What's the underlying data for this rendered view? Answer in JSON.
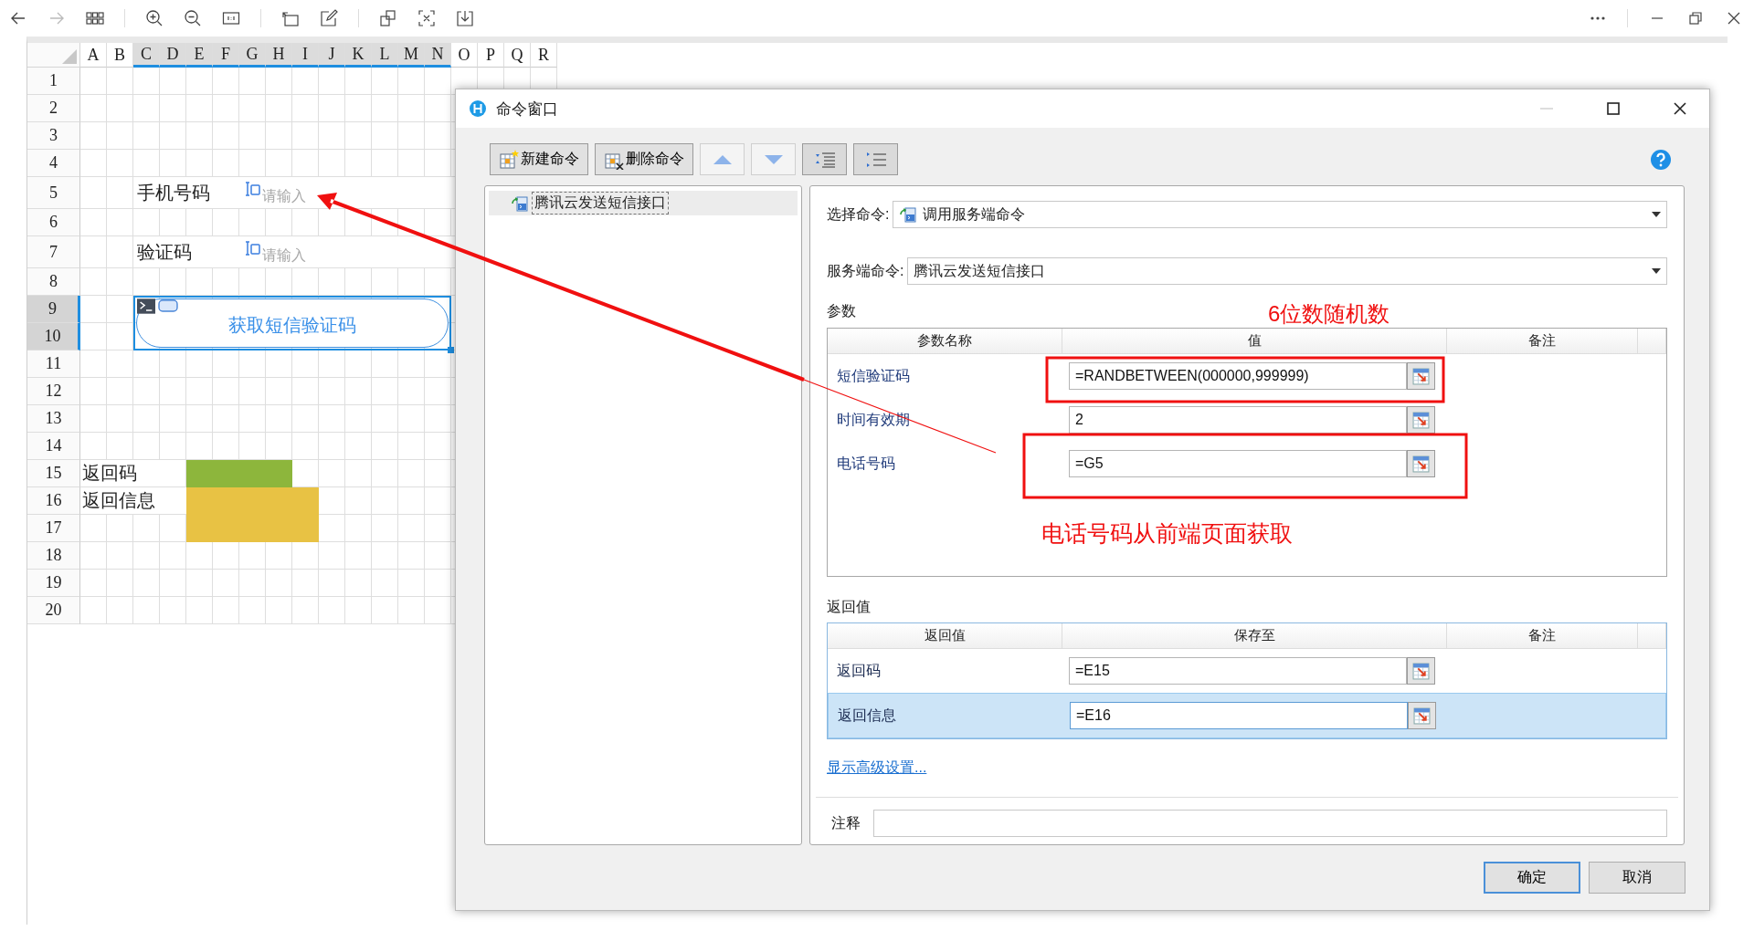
{
  "viewer": {
    "back": {
      "disabled": false
    },
    "forward": {
      "disabled": true
    }
  },
  "sheet": {
    "columns": [
      {
        "label": "A",
        "selected": false
      },
      {
        "label": "B",
        "selected": false
      },
      {
        "label": "C",
        "selected": true
      },
      {
        "label": "D",
        "selected": true
      },
      {
        "label": "E",
        "selected": true
      },
      {
        "label": "F",
        "selected": true
      },
      {
        "label": "G",
        "selected": true
      },
      {
        "label": "H",
        "selected": true
      },
      {
        "label": "I",
        "selected": true
      },
      {
        "label": "J",
        "selected": true
      },
      {
        "label": "K",
        "selected": true
      },
      {
        "label": "L",
        "selected": true
      },
      {
        "label": "M",
        "selected": true
      },
      {
        "label": "N",
        "selected": true
      },
      {
        "label": "O",
        "selected": false
      },
      {
        "label": "P",
        "selected": false
      },
      {
        "label": "Q",
        "selected": false
      },
      {
        "label": "R",
        "selected": false
      }
    ],
    "rows": [
      {
        "label": "1",
        "selected": false
      },
      {
        "label": "2",
        "selected": false
      },
      {
        "label": "3",
        "selected": false
      },
      {
        "label": "4",
        "selected": false
      },
      {
        "label": "5",
        "selected": false
      },
      {
        "label": "6",
        "selected": false
      },
      {
        "label": "7",
        "selected": false
      },
      {
        "label": "8",
        "selected": false
      },
      {
        "label": "9",
        "selected": true
      },
      {
        "label": "10",
        "selected": true
      },
      {
        "label": "11",
        "selected": false
      },
      {
        "label": "12",
        "selected": false
      },
      {
        "label": "13",
        "selected": false
      },
      {
        "label": "14",
        "selected": false
      },
      {
        "label": "15",
        "selected": false
      },
      {
        "label": "16",
        "selected": false
      },
      {
        "label": "17",
        "selected": false
      },
      {
        "label": "18",
        "selected": false
      },
      {
        "label": "19",
        "selected": false
      },
      {
        "label": "20",
        "selected": false
      }
    ],
    "labels": [
      {
        "text": "手机号码"
      },
      {
        "text": "验证码"
      },
      {
        "text": "返回码"
      },
      {
        "text": "返回信息"
      }
    ],
    "inputs": [
      {
        "placeholder": "请输入"
      },
      {
        "placeholder": "请输入"
      }
    ],
    "button": {
      "label": "获取短信验证码",
      "selected": true
    },
    "fills": [
      {
        "color": "#8db63c"
      },
      {
        "color": "#e8c244"
      }
    ]
  },
  "dialog": {
    "title": "命令窗口",
    "toolbar": [
      {
        "kind": "new",
        "label": "新建命令",
        "disabled": false
      },
      {
        "kind": "delete",
        "label": "删除命令",
        "disabled": false
      },
      {
        "kind": "up",
        "disabled": true
      },
      {
        "kind": "down",
        "disabled": true
      },
      {
        "kind": "expand",
        "disabled": false
      },
      {
        "kind": "collapse",
        "disabled": false
      }
    ],
    "commands": [
      {
        "label": "腾讯云发送短信接口",
        "selected": true
      }
    ],
    "select_command": {
      "label": "选择命令:",
      "value": "调用服务端命令"
    },
    "server_command": {
      "label": "服务端命令:",
      "value": "腾讯云发送短信接口"
    },
    "params": {
      "title": "参数",
      "columns": [
        "参数名称",
        "值",
        "备注"
      ],
      "rows": [
        {
          "name": "短信验证码",
          "value": "=RANDBETWEEN(000000,999999)"
        },
        {
          "name": "时间有效期",
          "value": "2"
        },
        {
          "name": "电话号码",
          "value": "=G5"
        }
      ]
    },
    "returns": {
      "title": "返回值",
      "columns": [
        "返回值",
        "保存至",
        "备注"
      ],
      "rows": [
        {
          "name": "返回码",
          "value": "=E15",
          "selected": false
        },
        {
          "name": "返回信息",
          "value": "=E16",
          "selected": true
        }
      ]
    },
    "advanced_link": "显示高级设置...",
    "note": {
      "label": "注释"
    },
    "buttons": [
      {
        "label": "确定",
        "default": true
      },
      {
        "label": "取消",
        "default": false
      }
    ]
  },
  "annotations": [
    {
      "text": "6位数随机数"
    },
    {
      "text": "电话号码从前端页面获取"
    }
  ]
}
